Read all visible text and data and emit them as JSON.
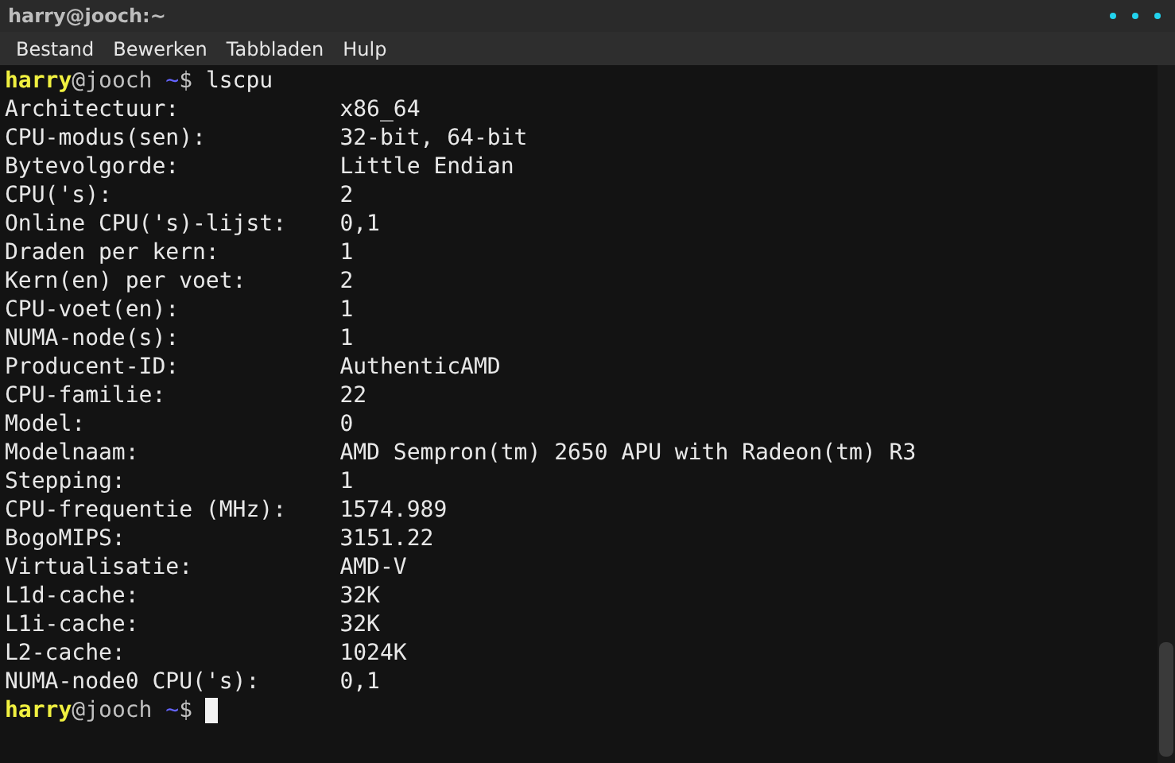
{
  "window": {
    "title": "harry@jooch:~"
  },
  "menu": [
    "Bestand",
    "Bewerken",
    "Tabbladen",
    "Hulp"
  ],
  "prompts": [
    {
      "user": "harry",
      "host": "@jooch",
      "path": "~",
      "symbol": "$",
      "command": "lscpu"
    },
    {
      "user": "harry",
      "host": "@jooch",
      "path": "~",
      "symbol": "$"
    }
  ],
  "output": [
    {
      "key": "Architectuur:",
      "value": "x86_64"
    },
    {
      "key": "CPU-modus(sen):",
      "value": "32-bit, 64-bit"
    },
    {
      "key": "Bytevolgorde:",
      "value": "Little Endian"
    },
    {
      "key": "CPU('s):",
      "value": "2"
    },
    {
      "key": "Online CPU('s)-lijst:",
      "value": "0,1"
    },
    {
      "key": "Draden per kern:",
      "value": "1"
    },
    {
      "key": "Kern(en) per voet:",
      "value": "2"
    },
    {
      "key": "CPU-voet(en):",
      "value": "1"
    },
    {
      "key": "NUMA-node(s):",
      "value": "1"
    },
    {
      "key": "Producent-ID:",
      "value": "AuthenticAMD"
    },
    {
      "key": "CPU-familie:",
      "value": "22"
    },
    {
      "key": "Model:",
      "value": "0"
    },
    {
      "key": "Modelnaam:",
      "value": "AMD Sempron(tm) 2650 APU with Radeon(tm) R3"
    },
    {
      "key": "Stepping:",
      "value": "1"
    },
    {
      "key": "CPU-frequentie (MHz):",
      "value": "1574.989"
    },
    {
      "key": "BogoMIPS:",
      "value": "3151.22"
    },
    {
      "key": "Virtualisatie:",
      "value": "AMD-V"
    },
    {
      "key": "L1d-cache:",
      "value": "32K"
    },
    {
      "key": "L1i-cache:",
      "value": "32K"
    },
    {
      "key": "L2-cache:",
      "value": "1024K"
    },
    {
      "key": "NUMA-node0 CPU('s):",
      "value": "0,1"
    }
  ]
}
